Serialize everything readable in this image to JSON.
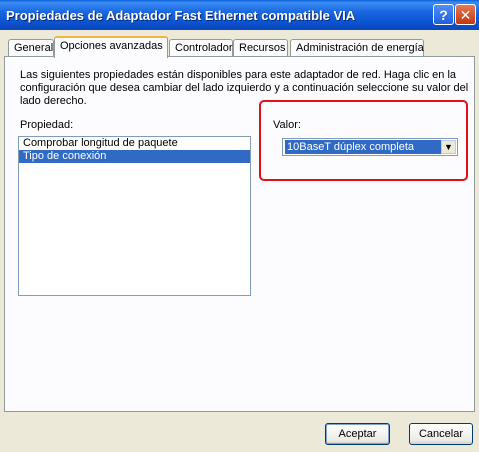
{
  "window": {
    "title": "Propiedades de Adaptador Fast Ethernet compatible VIA",
    "help_icon": "?",
    "close_icon": "✕"
  },
  "tabs": [
    {
      "label": "General"
    },
    {
      "label": "Opciones avanzadas"
    },
    {
      "label": "Controlador"
    },
    {
      "label": "Recursos"
    },
    {
      "label": "Administración de energía"
    }
  ],
  "active_tab": "Opciones avanzadas",
  "description": "Las siguientes propiedades están disponibles para este adaptador de red. Haga clic en la configuración que desea cambiar del lado izquierdo y a continuación seleccione su valor del lado derecho.",
  "property": {
    "label": "Propiedad:",
    "items": [
      {
        "label": "Comprobar longitud de paquete"
      },
      {
        "label": "Tipo de conexión"
      }
    ],
    "selected": "Tipo de conexión"
  },
  "value": {
    "label": "Valor:",
    "selected": "10BaseT dúplex completa",
    "arrow_icon": "▼"
  },
  "buttons": {
    "ok": "Aceptar",
    "cancel": "Cancelar"
  },
  "colors": {
    "titlebar": "#0a5fd8",
    "selection": "#316ac5",
    "highlight_box": "#e0111b"
  }
}
